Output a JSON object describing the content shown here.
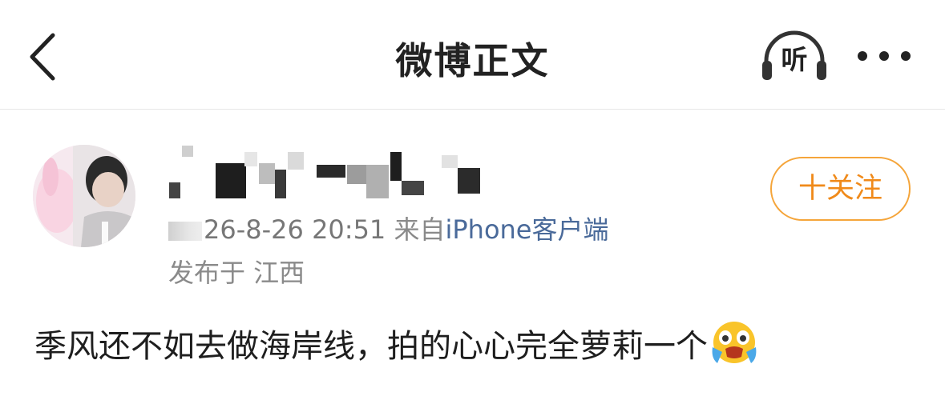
{
  "nav": {
    "title": "微博正文",
    "listen_label": "听",
    "icons": {
      "back": "chevron-left-icon",
      "listen": "headphones-icon",
      "more": "more-dots-icon"
    }
  },
  "post": {
    "time": "26-8-26 20:51",
    "from_label": "来自",
    "client": "iPhone客户端",
    "location": "发布于 江西",
    "follow_label": "十关注",
    "text": "季风还不如去做海岸线，拍的心心完全萝莉一个",
    "emoji": "crying-emoji"
  },
  "colors": {
    "accent": "#f08a1a",
    "link": "#4a6a9a",
    "meta": "#8a8a8a",
    "text": "#1e1e1e"
  }
}
